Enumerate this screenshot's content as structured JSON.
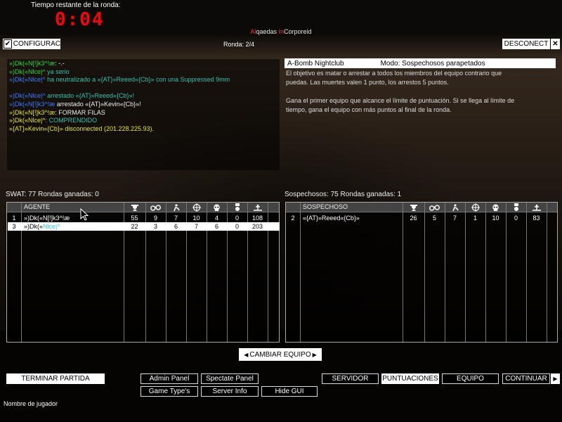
{
  "hud": {
    "timer_label": "Tiempo restante de la ronda:",
    "timer_value": "0:04",
    "server_name_a": "Al",
    "server_name_b": "qaedas ",
    "server_name_c": "In",
    "server_name_d": "Corporeid",
    "round_label": "Ronda: 2/4"
  },
  "top_buttons": {
    "config": "CONFIGURAC",
    "disconnect": "DESCONECT",
    "close_glyph": "✕",
    "check_glyph": "✔"
  },
  "chat": {
    "lines": [
      {
        "name": "»)Dk(«N[!]k3^!æ",
        "msg": ": -.-",
        "name_color": "g",
        "msg_color": "w"
      },
      {
        "name": "»)Dk(«Nlce|^",
        "msg": " ya serio",
        "name_color": "g",
        "msg_color": "c"
      },
      {
        "name": "»)Dk(«Nlce|^",
        "msg": " ha neutralizado a «{AT}»Reeed«{Cb}» con una Suppressed 9mm",
        "name_color": "b",
        "msg_color": "c"
      },
      {
        "name": "",
        "msg": "",
        "name_color": "w",
        "msg_color": "w"
      },
      {
        "name": "»)Dk(«Nlce|^",
        "msg": " arrestado «{AT}»Reeed«{Cb}»!",
        "name_color": "b",
        "msg_color": "c"
      },
      {
        "name": "»)Dk(«N[!]k3^!æ",
        "msg": " arrestado «{AT}»Kevin«{Cb}»!",
        "name_color": "b",
        "msg_color": "w"
      },
      {
        "name": "»)Dk(«N[!]k3^!æ",
        "msg": ": FORMAR FILAS",
        "name_color": "y",
        "msg_color": "w"
      },
      {
        "name": "»)Dk(«Nlce|^",
        "msg": ": COMPRENDIDO",
        "name_color": "y",
        "msg_color": "c"
      },
      {
        "name": "«{AT}»Kevin«{Cb}»",
        "msg": " disconnected (201.228.225.93).",
        "name_color": "y",
        "msg_color": "y"
      }
    ]
  },
  "map_info": {
    "map_name": "A-Bomb Nightclub",
    "mode": "Modo: Sospechosos parapetados",
    "description": "El objetivo es matar o arrestar a todos los miembros del equipo contrario que\npuedas. Las muertes valen 1 punto, los arrestos 5 puntos.\n\nGana el primer equipo que alcance el límite de puntuación. Si se llega al límite de\ntiempo, gana el equipo con más puntos al final de la ronda."
  },
  "teams": {
    "swat": {
      "label": "SWAT: 77 Rondas ganadas: 0",
      "header": "AGENTE",
      "rows": [
        {
          "id": "1",
          "name_a": "»)Dk(«N[!]k3^!æ",
          "name_b": "",
          "score": "55",
          "c2": "9",
          "c3": "7",
          "c4": "10",
          "c5": "4",
          "c6": "0",
          "ping": "108",
          "selected": false
        },
        {
          "id": "3",
          "name_a": "»)Dk(«",
          "name_b": "Nlce|^",
          "score": "22",
          "c2": "3",
          "c3": "6",
          "c4": "7",
          "c5": "6",
          "c6": "0",
          "ping": "203",
          "selected": true
        }
      ]
    },
    "suspects": {
      "label": "Sospechosos: 75 Rondas ganadas: 1",
      "header": "SOSPECHOSO",
      "rows": [
        {
          "id": "2",
          "name_a": "«{AT}»Reeed«{Cb}»",
          "name_b": "",
          "score": "26",
          "c2": "5",
          "c3": "7",
          "c4": "1",
          "c5": "10",
          "c6": "0",
          "ping": "83",
          "selected": false
        }
      ]
    },
    "column_icons": [
      "trophy-icon",
      "handcuffs-icon",
      "arrest-icon",
      "crosshair-icon",
      "skull-icon",
      "medal-icon",
      "ping-icon"
    ]
  },
  "buttons": {
    "change_team": "CAMBIAR EQUIPO",
    "end_match": "TERMINAR PARTIDA",
    "admin_panel": "Admin Panel",
    "spectate_panel": "Spectate Panel",
    "game_types": "Game Type's",
    "server_info": "Server Info",
    "hide_gui": "Hide GUI",
    "servidor": "SERVIDOR",
    "puntuaciones": "PUNTUACIONES",
    "equipo": "EQUIPO",
    "continuar": "CONTINUAR"
  },
  "footer": {
    "player_name_label": "Nombre de jugador"
  },
  "colors": {
    "timer": "#dd1111",
    "accent_red": "#e23b3b",
    "chat_green": "#36d636",
    "chat_yellow": "#e4e432",
    "chat_blue": "#3d7cff",
    "chat_cyan": "#36bfb0"
  }
}
